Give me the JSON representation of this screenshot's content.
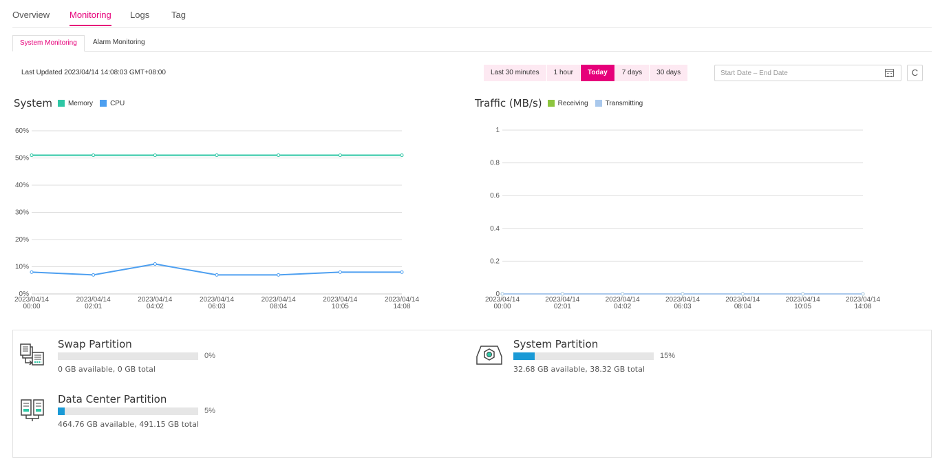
{
  "tabs": [
    {
      "label": "Overview",
      "active": false
    },
    {
      "label": "Monitoring",
      "active": true
    },
    {
      "label": "Logs",
      "active": false
    },
    {
      "label": "Tag",
      "active": false
    }
  ],
  "subtabs": [
    {
      "label": "System Monitoring",
      "active": true
    },
    {
      "label": "Alarm Monitoring",
      "active": false
    }
  ],
  "last_updated": {
    "label": "Last Updated",
    "value": "2023/04/14 14:08:03 GMT+08:00"
  },
  "time_range": {
    "options": [
      "Last 30 minutes",
      "1 hour",
      "Today",
      "7 days",
      "30 days"
    ],
    "selected": "Today"
  },
  "date_picker": {
    "placeholder": "Start Date – End Date"
  },
  "refresh": {
    "glyph": "C"
  },
  "colors": {
    "accent": "#e6007a",
    "memory": "#2ec7a5",
    "cpu": "#4d9ff0",
    "receiving": "#8dc63f",
    "transmitting": "#a9c8ec",
    "partition_fill": "#1a9ad6"
  },
  "chart_data": [
    {
      "type": "line",
      "title": "System",
      "x": [
        "2023/04/14 00:00",
        "2023/04/14 02:01",
        "2023/04/14 04:02",
        "2023/04/14 06:03",
        "2023/04/14 08:04",
        "2023/04/14 10:05",
        "2023/04/14 14:08"
      ],
      "series": [
        {
          "name": "Memory",
          "values": [
            51,
            51,
            51,
            51,
            51,
            51,
            51
          ]
        },
        {
          "name": "CPU",
          "values": [
            8,
            7,
            11,
            7,
            7,
            8,
            8
          ]
        }
      ],
      "yticks": [
        "0%",
        "10%",
        "20%",
        "30%",
        "40%",
        "50%",
        "60%"
      ],
      "ylim": [
        0,
        60
      ],
      "grid": true,
      "legend": "top-left"
    },
    {
      "type": "line",
      "title": "Traffic (MB/s)",
      "x": [
        "2023/04/14 00:00",
        "2023/04/14 02:01",
        "2023/04/14 04:02",
        "2023/04/14 06:03",
        "2023/04/14 08:04",
        "2023/04/14 10:05",
        "2023/04/14 14:08"
      ],
      "series": [
        {
          "name": "Receiving",
          "values": [
            0,
            0,
            0,
            0,
            0,
            0,
            0
          ]
        },
        {
          "name": "Transmitting",
          "values": [
            0,
            0,
            0,
            0,
            0,
            0,
            0
          ]
        }
      ],
      "yticks": [
        "0",
        "0.2",
        "0.4",
        "0.6",
        "0.8",
        "1"
      ],
      "ylim": [
        0,
        1
      ],
      "grid": true,
      "legend": "top-left"
    }
  ],
  "partitions": {
    "swap": {
      "title": "Swap Partition",
      "percent": 0,
      "percent_label": "0%",
      "detail": "0 GB available, 0 GB total",
      "icon": "swap-partition-icon"
    },
    "system": {
      "title": "System Partition",
      "percent": 15,
      "percent_label": "15%",
      "detail": "32.68 GB available, 38.32 GB total",
      "icon": "system-partition-icon"
    },
    "datacenter": {
      "title": "Data Center Partition",
      "percent": 5,
      "percent_label": "5%",
      "detail": "464.76 GB available, 491.15 GB total",
      "icon": "data-center-partition-icon"
    }
  }
}
